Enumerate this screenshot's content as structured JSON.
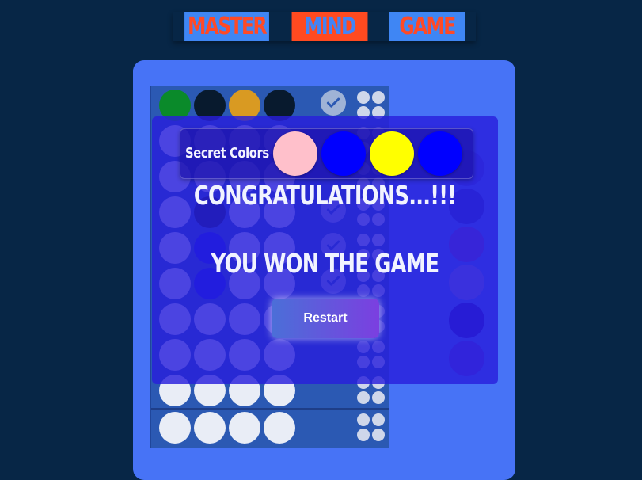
{
  "header": {
    "seg1": "MASTER",
    "seg2": "MIND",
    "seg3": "GAME"
  },
  "board": {
    "rows": [
      {
        "pegs": [
          "#0a8a2a",
          "#081a2e",
          "#d99a22",
          "#081a2e"
        ],
        "checked": true
      },
      {
        "pegs": [
          "#e9edf6",
          "#e9edf6",
          "#e9edf6",
          "#e9edf6"
        ],
        "checked": false
      },
      {
        "pegs": [
          "#e9edf6",
          "#e9edf6",
          "#e9edf6",
          "#e9edf6"
        ],
        "checked": false
      },
      {
        "pegs": [
          "#e9edf6",
          "#081a2e",
          "#e9edf6",
          "#e9edf6"
        ],
        "checked": true
      },
      {
        "pegs": [
          "#e9edf6",
          "#0a1ae8",
          "#e9edf6",
          "#e9edf6"
        ],
        "checked": true
      },
      {
        "pegs": [
          "#e9edf6",
          "#0a1ae8",
          "#e9edf6",
          "#e9edf6"
        ],
        "checked": true
      },
      {
        "pegs": [
          "#e9edf6",
          "#e9edf6",
          "#e9edf6",
          "#e9edf6"
        ],
        "checked": false
      },
      {
        "pegs": [
          "#e9edf6",
          "#e9edf6",
          "#e9edf6",
          "#e9edf6"
        ],
        "checked": false
      },
      {
        "pegs": [
          "#e9edf6",
          "#e9edf6",
          "#e9edf6",
          "#e9edf6"
        ],
        "checked": false
      },
      {
        "pegs": [
          "#e9edf6",
          "#e9edf6",
          "#e9edf6",
          "#e9edf6"
        ],
        "checked": false
      }
    ]
  },
  "palette": [
    "#3e4fd9",
    "#2a3ac2",
    "#7d45c8",
    "#8c86e2",
    "#2411b4",
    "#5a3ed8"
  ],
  "modal": {
    "secret_label": "Secret Colors :",
    "secret_colors": [
      "#ffc0cb",
      "#0000ff",
      "#ffff00",
      "#0000ff"
    ],
    "congrats": "CONGRATULATIONS...!!!",
    "won": "YOU WON THE GAME",
    "restart_label": "Restart"
  }
}
